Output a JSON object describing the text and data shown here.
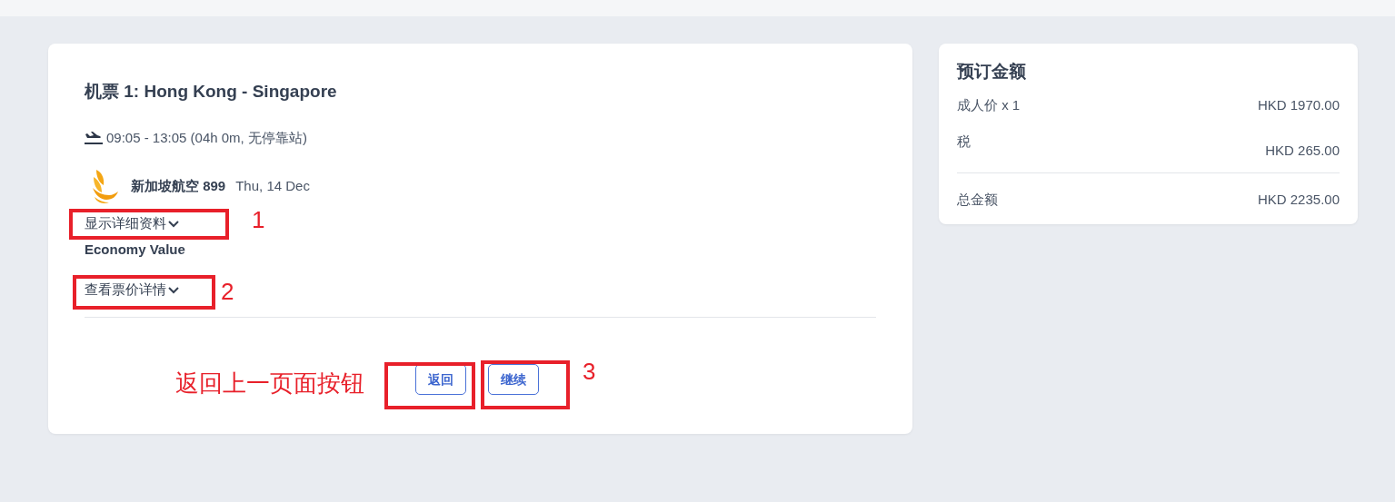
{
  "flight": {
    "title": "机票 1: Hong Kong - Singapore",
    "schedule": "09:05 - 13:05 (04h 0m, 无停靠站)",
    "airline": "新加坡航空 899",
    "date": "Thu, 14 Dec",
    "details_link": "显示详细资料",
    "fare_class": "Economy Value",
    "fare_link": "查看票价详情"
  },
  "buttons": [
    {
      "label": "返回"
    },
    {
      "label": "继续"
    }
  ],
  "annotations": [
    {
      "number": "1"
    },
    {
      "number": "2"
    },
    {
      "number": "3"
    }
  ],
  "annotation_note": "返回上一页面按钮",
  "summary": {
    "title": "预订金额",
    "rows": [
      {
        "label": "成人价 x 1",
        "amount": "HKD 1970.00"
      },
      {
        "label": "税",
        "amount": "HKD 265.00"
      }
    ],
    "total": {
      "label": "总金额",
      "amount": "HKD 2235.00"
    }
  }
}
